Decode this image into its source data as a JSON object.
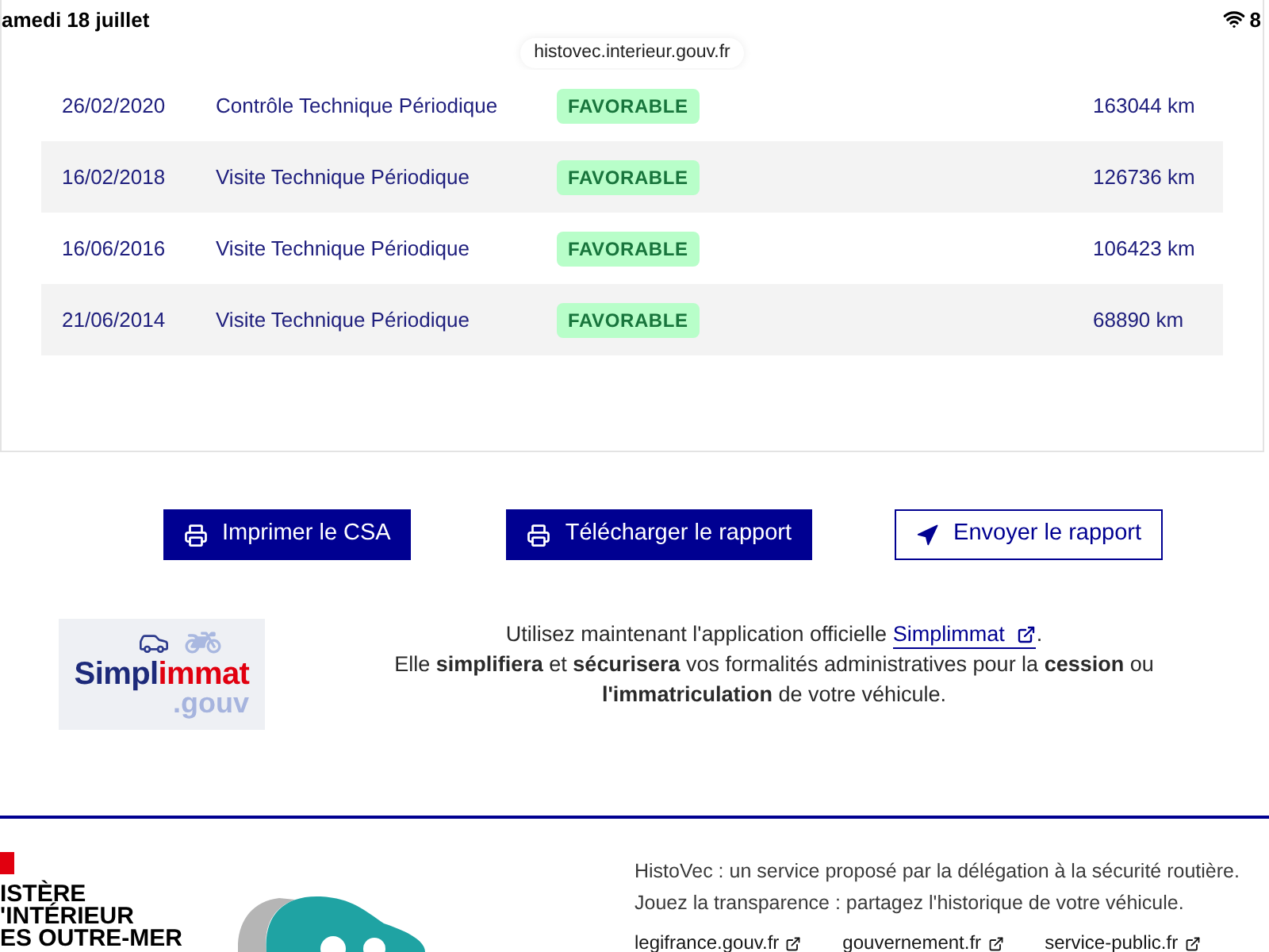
{
  "status_bar": {
    "date": "amedi 18 juillet",
    "battery": "8"
  },
  "address_bar": {
    "url": "histovec.interieur.gouv.fr"
  },
  "inspections": {
    "rows": [
      {
        "date": "26/02/2020",
        "type": "Contrôle Technique Périodique",
        "result": "FAVORABLE",
        "kind": "favorable",
        "mileage": "163044 km"
      },
      {
        "date": "16/02/2018",
        "type": "Visite Technique Périodique",
        "result": "FAVORABLE",
        "kind": "favorable",
        "mileage": "126736 km"
      },
      {
        "date": "16/06/2016",
        "type": "Visite Technique Périodique",
        "result": "FAVORABLE",
        "kind": "favorable",
        "mileage": "106423 km"
      },
      {
        "date": "21/06/2014",
        "type": "Visite Technique Périodique",
        "result": "FAVORABLE",
        "kind": "favorable",
        "mileage": "68890 km"
      }
    ]
  },
  "actions": [
    {
      "label": "Imprimer le CSA",
      "kind": "primary"
    },
    {
      "label": "Télécharger le rapport",
      "kind": "primary"
    },
    {
      "label": "Envoyer le rapport",
      "kind": "secondary"
    }
  ],
  "simplimmat": {
    "wordmark": [
      "Simpl",
      "immat"
    ],
    "suffix": ".gouv",
    "intro": "Utilisez maintenant l'application officielle",
    "link": "Simplimmat",
    "intro_end": ".",
    "description": "Elle **simplifiera** et **sécurisera** vos formalités administratives pour la **cession** ou **l'immatriculation** de votre véhicule."
  },
  "footer": {
    "ministry_lines": [
      "ISTÈRE",
      "'INTÉRIEUR",
      "ES OUTRE-MER"
    ],
    "about": [
      "HistoVec : un service proposé par la délégation à la sécurité routière.",
      "Jouez la transparence : partagez l'historique de votre véhicule."
    ],
    "links": [
      "legifrance.gouv.fr",
      "gouvernement.fr",
      "service-public.fr"
    ]
  }
}
